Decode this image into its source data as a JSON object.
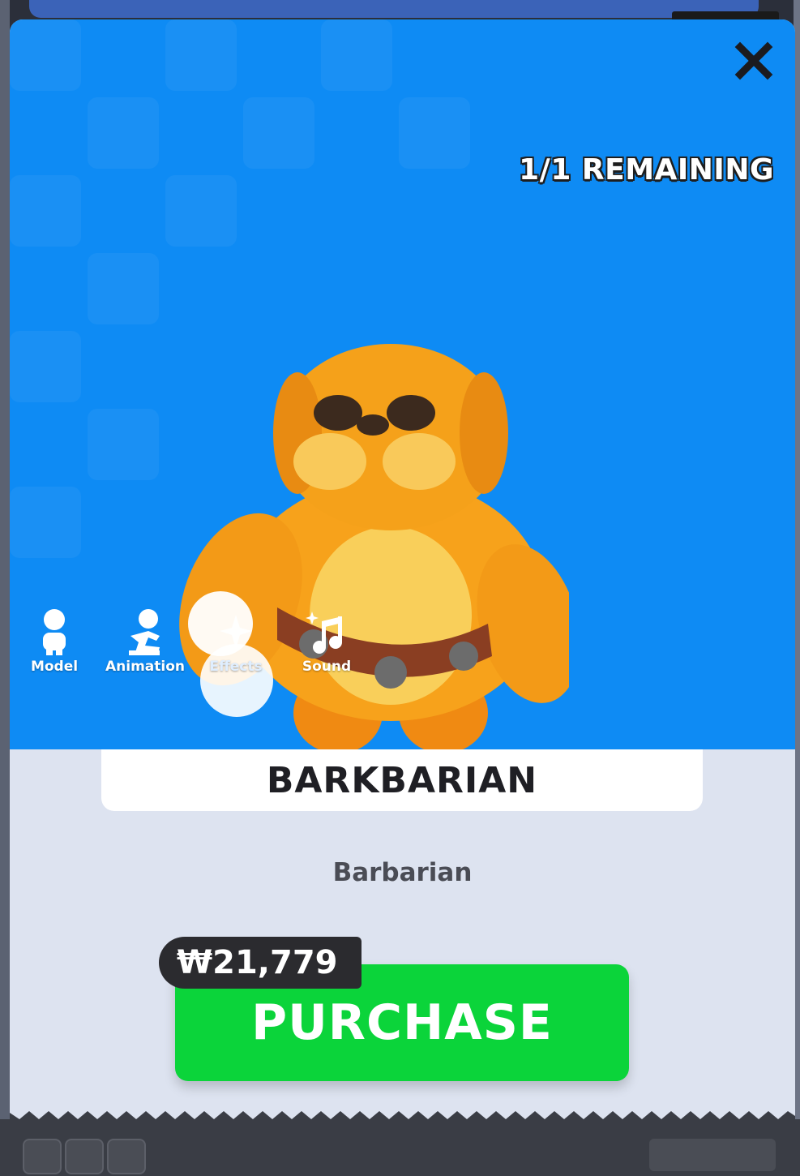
{
  "header": {
    "close_icon": "close-icon",
    "remaining": "1/1 REMAINING"
  },
  "tabs": [
    {
      "label": "Model",
      "icon": "person-icon"
    },
    {
      "label": "Animation",
      "icon": "running-person-icon"
    },
    {
      "label": "Effects",
      "icon": "sparkle-burst-icon"
    },
    {
      "label": "Sound",
      "icon": "music-note-icon"
    }
  ],
  "item": {
    "name": "BARKBARIAN",
    "category": "Barbarian"
  },
  "purchase": {
    "price": "₩21,779",
    "button_label": "PURCHASE"
  },
  "colors": {
    "hero_bg": "#0e8bf4",
    "purchase_green": "#0bd43a",
    "price_tag_bg": "#2b2b2f"
  }
}
